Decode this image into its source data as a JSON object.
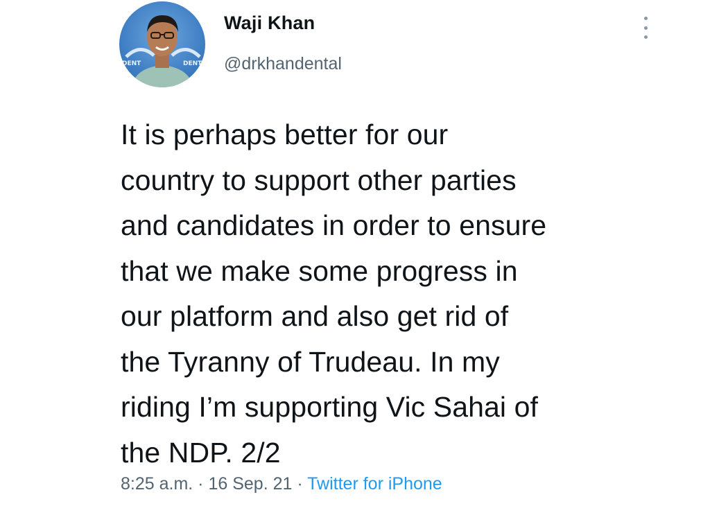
{
  "author": {
    "name": "Waji Khan",
    "handle": "@drkhandental",
    "avatar_badge_text": "DENT"
  },
  "tweet": {
    "lines": [
      "It is perhaps better for our",
      "country to support other parties",
      "and candidates in order to ensure",
      "that we make some progress in",
      "our platform and also get rid of",
      "the Tyranny of Trudeau. In my",
      "riding I’m supporting Vic Sahai of",
      "the NDP. 2/2"
    ]
  },
  "meta": {
    "time": "8:25 a.m.",
    "separator": " · ",
    "date": "16 Sep. 21",
    "separator2": " · ",
    "source": "Twitter for iPhone"
  },
  "icons": {
    "more": "more-vertical-icon"
  },
  "colors": {
    "text": "#0f1419",
    "secondary": "#536471",
    "link": "#1d9bf0"
  }
}
